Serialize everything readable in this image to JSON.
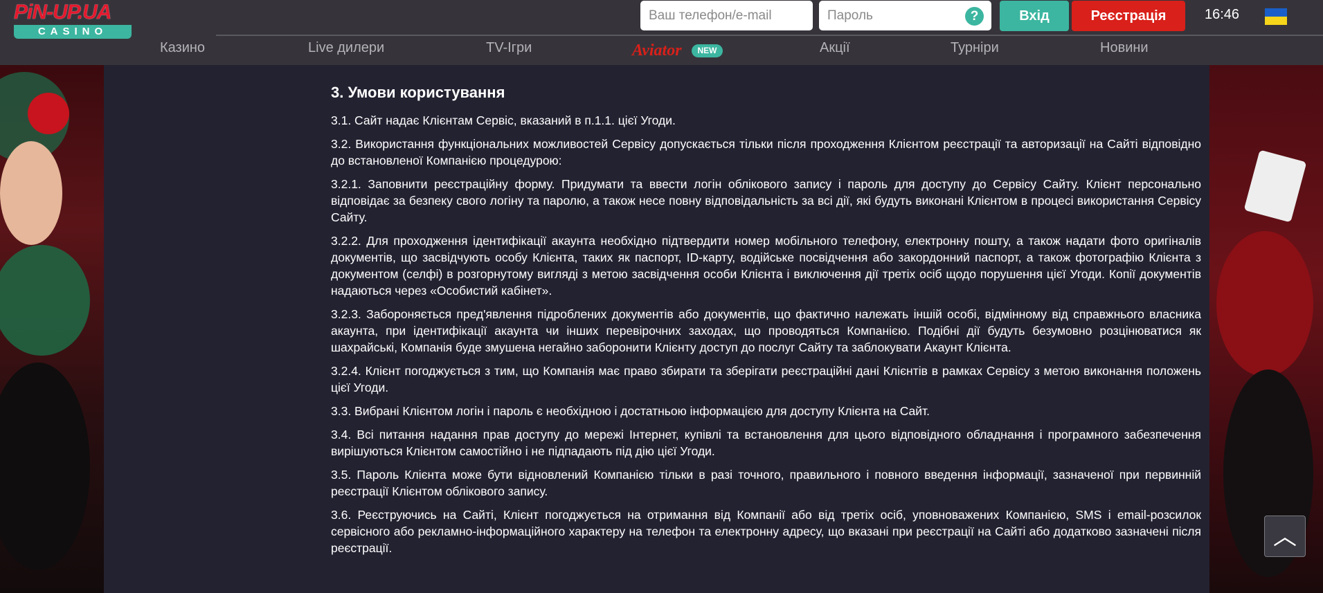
{
  "header": {
    "logo": {
      "top": "PiN-UP.UA",
      "bottom": "CASINO"
    },
    "phone_placeholder": "Ваш телефон/e-mail",
    "password_placeholder": "Пароль",
    "help_symbol": "?",
    "login_label": "Вхід",
    "register_label": "Реєстрація",
    "time": "16:46",
    "language_flag": "ukraine-flag-icon",
    "colors": {
      "accent": "#3cb6a0",
      "register": "#d9201a",
      "bar": "#36343a"
    }
  },
  "nav": {
    "items": [
      {
        "label": "Казино"
      },
      {
        "label": "Live дилери"
      },
      {
        "label": "TV-Ігри"
      },
      {
        "label": "Aviator",
        "badge": "NEW"
      },
      {
        "label": "Акції"
      },
      {
        "label": "Турніри"
      },
      {
        "label": "Новини"
      }
    ]
  },
  "document": {
    "title": "3. Умови користування",
    "paragraphs": [
      "3.1. Сайт надає Клієнтам Сервіс, вказаний в п.1.1. цієї Угоди.",
      "3.2. Використання функціональних можливостей Сервісу допускається тільки після проходження Клієнтом реєстрації та авторизації на Сайті відповідно до встановленої Компанією процедурою:",
      "3.2.1. Заповнити реєстраційну форму. Придумати та ввести логін облікового запису і пароль для доступу до Сервісу Сайту. Клієнт персонально відповідає за безпеку свого логіну та паролю, а також несе повну відповідальність за всі дії, які будуть виконані Клієнтом в процесі використання Сервісу Сайту.",
      "3.2.2. Для проходження ідентифікації акаунта необхідно підтвердити номер мобільного телефону, електронну пошту, а також надати фото оригіналів документів, що засвідчують особу Клієнта, таких як паспорт, ID-карту, водійське посвідчення або закордонний паспорт, а також фотографію Клієнта з документом (селфі) в розгорнутому вигляді з метою засвідчення особи Клієнта і виключення дії третіх осіб щодо порушення цієї Угоди. Копії документів надаються через «Особистий кабінет».",
      "3.2.3. Забороняється пред'явлення підроблених документів або документів, що фактично належать іншій особі, відмінному від справжнього власника акаунта, при ідентифікації акаунта чи інших перевірочних заходах, що проводяться Компанією. Подібні дії будуть безумовно розцінюватися як шахрайські, Компанія буде змушена негайно заборонити Клієнту доступ до послуг Сайту та заблокувати Акаунт Клієнта.",
      "3.2.4. Клієнт погоджується з тим, що Компанія має право збирати та зберігати реєстраційні дані Клієнтів в рамках Сервісу з метою виконання положень цієї Угоди.",
      "3.3. Вибрані Клієнтом логін і пароль є необхідною і достатньою інформацією для доступу Клієнта на Сайт.",
      "3.4. Всі питання надання прав доступу до мережі Інтернет, купівлі та встановлення для цього відповідного обладнання і програмного забезпечення вирішуються Клієнтом самостійно і не підпадають під дію цієї Угоди.",
      "3.5. Пароль Клієнта може бути відновлений Компанією тільки в разі точного, правильного і повного введення інформації, зазначеної при первинній реєстрації Клієнтом облікового запису.",
      "3.6. Реєструючись на Сайті, Клієнт погоджується на отримання від Компанії або від третіх осіб, уповноважених Компанією, SMS і email-розсилок сервісного або рекламно-інформаційного характеру на телефон та електронну адресу, що вказані при реєстрації на Сайті або додатково зазначені після реєстрації."
    ]
  },
  "scroll_top": {
    "icon": "chevron-up-icon",
    "symbol": "︿"
  }
}
